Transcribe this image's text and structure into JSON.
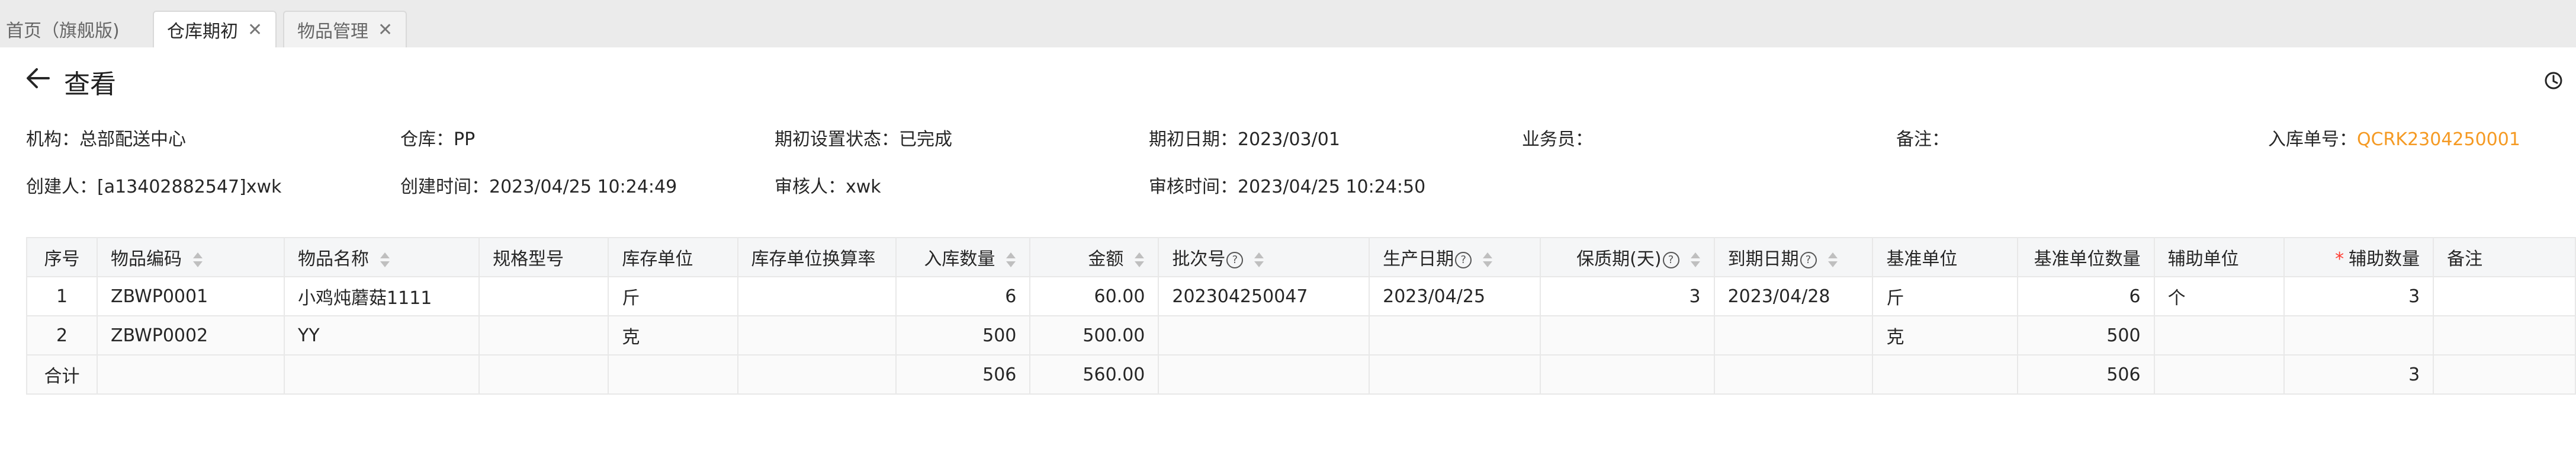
{
  "tabs": [
    {
      "label": "首页（旗舰版)"
    },
    {
      "label": "仓库期初"
    },
    {
      "label": "物品管理"
    }
  ],
  "header": {
    "title": "查看"
  },
  "info": {
    "org_label": "机构：",
    "org_value": "总部配送中心",
    "warehouse_label": "仓库：",
    "warehouse_value": "PP",
    "status_label": "期初设置状态：",
    "status_value": "已完成",
    "date_label": "期初日期：",
    "date_value": "2023/03/01",
    "salesman_label": "业务员：",
    "salesman_value": "",
    "remark_label": "备注：",
    "remark_value": "",
    "inbound_no_label": "入库单号：",
    "inbound_no_value": "QCRK2304250001",
    "creator_label": "创建人：",
    "creator_value": "[a13402882547]xwk",
    "created_time_label": "创建时间：",
    "created_time_value": "2023/04/25 10:24:49",
    "auditor_label": "审核人：",
    "auditor_value": "xwk",
    "audit_time_label": "审核时间：",
    "audit_time_value": "2023/04/25 10:24:50"
  },
  "table": {
    "headers": {
      "seq": "序号",
      "code": "物品编码",
      "name": "物品名称",
      "spec": "规格型号",
      "unit": "库存单位",
      "rate": "库存单位换算率",
      "qty": "入库数量",
      "amount": "金额",
      "batch": "批次号",
      "prod_date": "生产日期",
      "shelf": "保质期(天)",
      "expire": "到期日期",
      "base_unit": "基准单位",
      "base_qty": "基准单位数量",
      "aux_unit": "辅助单位",
      "aux_qty_req": "*",
      "aux_qty": "辅助数量",
      "remark": "备注"
    },
    "rows": [
      {
        "seq": "1",
        "code": "ZBWP0001",
        "name": "小鸡炖蘑菇1111",
        "spec": "",
        "unit": "斤",
        "rate": "",
        "qty": "6",
        "amount": "60.00",
        "batch": "202304250047",
        "prod_date": "2023/04/25",
        "shelf": "3",
        "expire": "2023/04/28",
        "base_unit": "斤",
        "base_qty": "6",
        "aux_unit": "个",
        "aux_qty": "3",
        "remark": ""
      },
      {
        "seq": "2",
        "code": "ZBWP0002",
        "name": "YY",
        "spec": "",
        "unit": "克",
        "rate": "",
        "qty": "500",
        "amount": "500.00",
        "batch": "",
        "prod_date": "",
        "shelf": "",
        "expire": "",
        "base_unit": "克",
        "base_qty": "500",
        "aux_unit": "",
        "aux_qty": "",
        "remark": ""
      }
    ],
    "total": {
      "label": "合计",
      "qty": "506",
      "amount": "560.00",
      "base_qty": "506",
      "aux_qty": "3"
    }
  },
  "colors": {
    "accent_link": "#f59a23",
    "required": "#ff3b30",
    "tabbar_bg": "#ebebeb"
  },
  "icons": [
    "back-arrow-icon",
    "close-icon",
    "sort-icon",
    "help-icon",
    "clock-icon"
  ]
}
